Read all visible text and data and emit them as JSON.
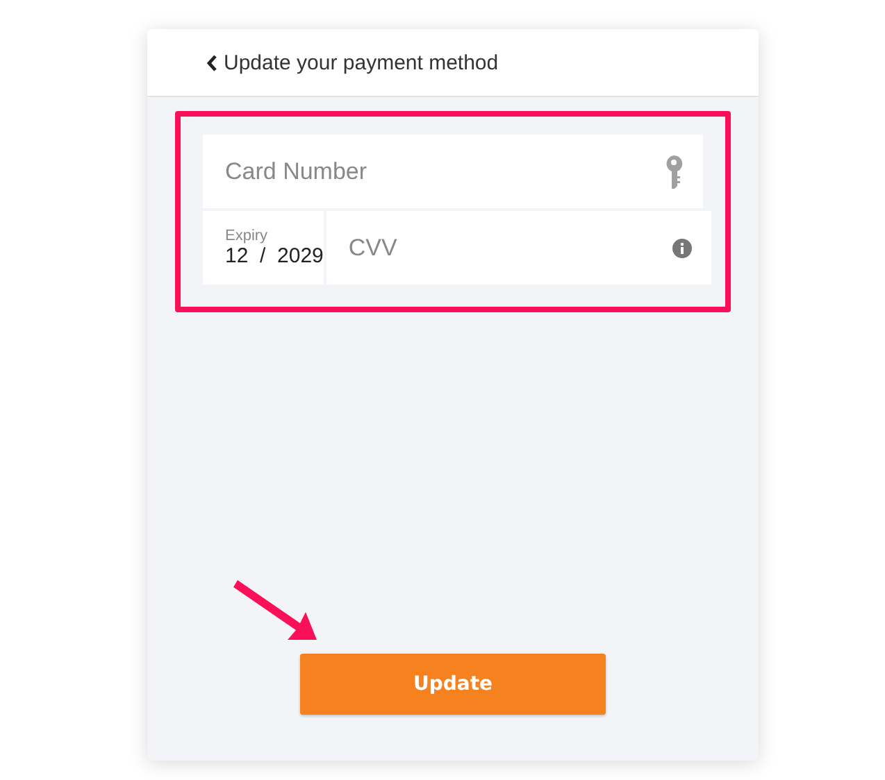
{
  "header": {
    "title": "Update your payment method"
  },
  "form": {
    "card_number": {
      "placeholder": "Card Number"
    },
    "expiry": {
      "label": "Expiry",
      "value": "12  /  2029"
    },
    "cvv": {
      "placeholder": "CVV"
    }
  },
  "buttons": [
    {
      "label": "Update"
    }
  ]
}
